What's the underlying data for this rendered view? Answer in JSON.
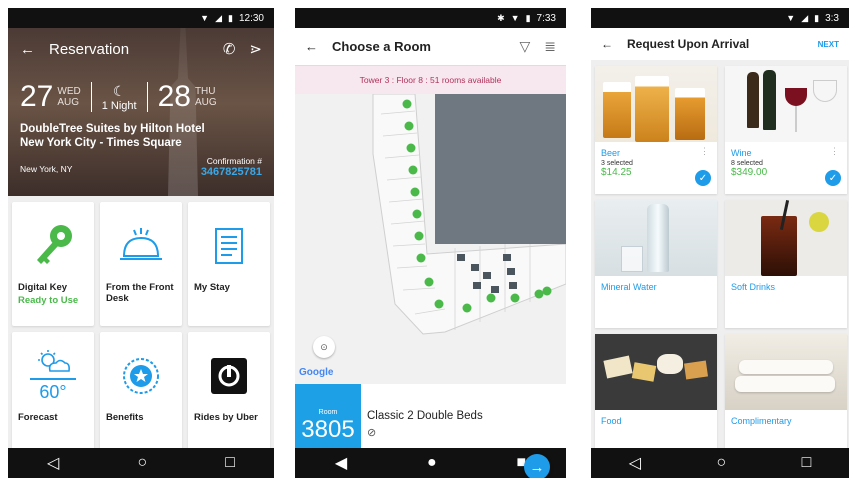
{
  "phone1": {
    "status_time": "12:30",
    "title": "Reservation",
    "checkin": {
      "day": "27",
      "weekday": "WED",
      "month": "AUG"
    },
    "nights": "1 Night",
    "checkout": {
      "day": "28",
      "weekday": "THU",
      "month": "AUG"
    },
    "hotel_line1": "DoubleTree Suites by Hilton Hotel",
    "hotel_line2": "New York City - Times Square",
    "city": "New York, NY",
    "confirmation_label": "Confirmation #",
    "confirmation_number": "3467825781",
    "tiles": [
      {
        "label": "Digital Key",
        "sub": "Ready to Use",
        "icon": "key-icon"
      },
      {
        "label": "From the Front Desk",
        "sub": "",
        "icon": "bell-icon"
      },
      {
        "label": "My Stay",
        "sub": "",
        "icon": "document-icon"
      },
      {
        "label": "Forecast",
        "sub": "",
        "icon": "weather-icon",
        "temp": "60°"
      },
      {
        "label": "Benefits",
        "sub": "",
        "icon": "star-badge-icon"
      },
      {
        "label": "Rides by Uber",
        "sub": "",
        "icon": "uber-icon"
      }
    ]
  },
  "phone2": {
    "status_time": "7:33",
    "title": "Choose a Room",
    "availability": "Tower 3 : Floor 8 : 51 rooms available",
    "google": "Google",
    "room_label": "Room",
    "room_number": "3805",
    "room_type": "Classic 2 Double Beds",
    "nosmoke": "⃠"
  },
  "phone3": {
    "status_time": "3:3",
    "title": "Request Upon Arrival",
    "next": "NEXT",
    "items": [
      {
        "name": "Beer",
        "selected": "3 selected",
        "price": "$14.25",
        "checked": true
      },
      {
        "name": "Wine",
        "selected": "8 selected",
        "price": "$349.00",
        "checked": true
      },
      {
        "name": "Mineral Water",
        "selected": "",
        "price": "",
        "checked": false
      },
      {
        "name": "Soft Drinks",
        "selected": "",
        "price": "",
        "checked": false
      },
      {
        "name": "Food",
        "selected": "",
        "price": "",
        "checked": false
      },
      {
        "name": "Complimentary",
        "selected": "",
        "price": "",
        "checked": false
      }
    ]
  },
  "colors": {
    "accent": "#1e9be9",
    "green": "#4ab94a",
    "availability_text": "#b0335a"
  }
}
